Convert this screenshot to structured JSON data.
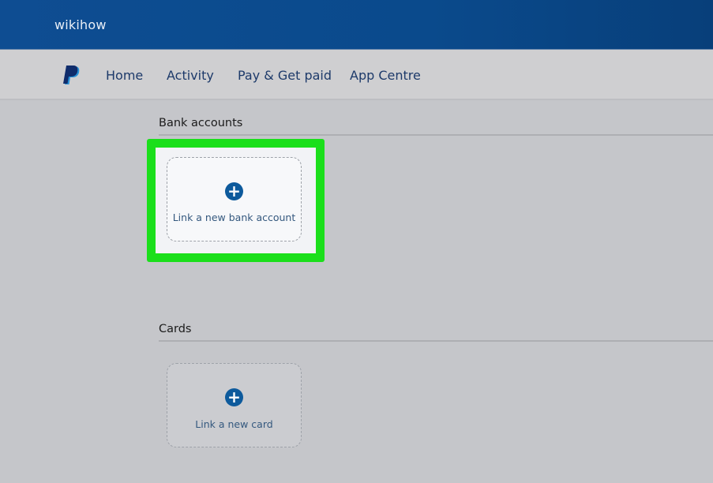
{
  "topbar": {
    "brand": "wikihow"
  },
  "nav": {
    "logo": "paypal-logo-icon",
    "items": [
      {
        "label": "Home"
      },
      {
        "label": "Activity"
      },
      {
        "label": "Pay & Get paid"
      },
      {
        "label": "App Centre"
      }
    ]
  },
  "bank_accounts": {
    "title": "Bank accounts",
    "add_label": "Link a new bank account",
    "add_icon": "plus-icon",
    "highlighted": true
  },
  "cards": {
    "title": "Cards",
    "add_label": "Link a new card",
    "add_icon": "plus-icon"
  },
  "colors": {
    "topbar": "#0e4d92",
    "nav_text": "#1d3a6a",
    "highlight": "#1bdf1b",
    "plus_icon": "#0d5a9c"
  }
}
